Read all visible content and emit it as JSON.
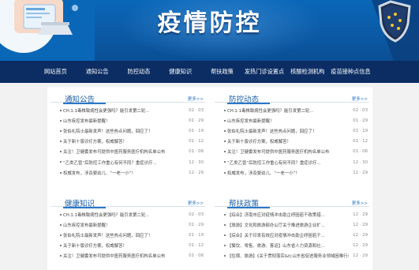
{
  "banner": {
    "title": "疫情防控"
  },
  "nav": {
    "items": [
      {
        "label": "网站首页"
      },
      {
        "label": "通知公告"
      },
      {
        "label": "防控动态"
      },
      {
        "label": "健康知识"
      },
      {
        "label": "帮扶政策"
      },
      {
        "label": "发热门诊设置点"
      },
      {
        "label": "核酸检测机构"
      },
      {
        "label": "疫苗接种点信息"
      }
    ]
  },
  "panels": {
    "notices": {
      "title": "通知公告",
      "more": "更多>>",
      "items": [
        {
          "text": "CH.1.1毒株致病性会更强吗？能引发第二轮...",
          "date": "02 · 03"
        },
        {
          "text": "山东疾控发布最新提醒！",
          "date": "01 · 29"
        },
        {
          "text": "张伯礼院士最新发声！这些热点问题，回应了！",
          "date": "01 · 19"
        },
        {
          "text": "关于新十版诊疗方案，权威解答！",
          "date": "01 · 12"
        },
        {
          "text": "关注！卫健委发布可提供中医药服务医疗机构名单公布",
          "date": "01 · 06"
        },
        {
          "text": "“乙类乙管”后防控工作重心有何不同？重症诊疗...",
          "date": "12 · 30"
        },
        {
          "text": "权威发布，涉及婴幼儿、“一老一小”！",
          "date": "12 · 29"
        }
      ]
    },
    "dynamics": {
      "title": "防控动态",
      "more": "更多>>",
      "items": [
        {
          "text": "CH.1.1毒株致病性会更强吗？能引发第二轮...",
          "date": "02 · 03"
        },
        {
          "text": "山东疾控发布最新提醒！",
          "date": "01 · 29"
        },
        {
          "text": "张伯礼院士最新发声！这些热点问题，回应了！",
          "date": "01 · 19"
        },
        {
          "text": "关于新十版诊疗方案，权威解答！",
          "date": "01 · 12"
        },
        {
          "text": "关注！卫健委发布可提供中医药服务医疗机构名单公布",
          "date": "01 · 06"
        },
        {
          "text": "“乙类乙管”后防控工作重心有何不同？重症诊疗...",
          "date": "12 · 30"
        },
        {
          "text": "权威发布，涉及婴幼儿、“一老一小”！",
          "date": "12 · 29"
        }
      ]
    },
    "health": {
      "title": "健康知识",
      "more": "更多>>",
      "items": [
        {
          "text": "CH.1.1毒株致病性会更强吗？能引发第二轮...",
          "date": "02 · 03"
        },
        {
          "text": "山东疾控发布最新提醒！",
          "date": "01 · 29"
        },
        {
          "text": "张伯礼院士最新发声！这些热点问题，回应了！",
          "date": "01 · 19"
        },
        {
          "text": "关于新十版诊疗方案，权威解答！",
          "date": "01 · 12"
        },
        {
          "text": "关注！卫健委发布可提供中医药服务医疗机构名单公布",
          "date": "01 · 06"
        }
      ]
    },
    "policy": {
      "title": "帮扶政策",
      "more": "更多>>",
      "items": [
        {
          "text": "【综合】济南市应对疫情冲击助企纾困若干政策措...",
          "date": "12 · 29"
        },
        {
          "text": "【旅游】文化和旅游部办公厅关于推进旅游企业扩...",
          "date": "12 · 29"
        },
        {
          "text": "【综合】关于印发有效应对疫情冲击助企纾困若干...",
          "date": "12 · 29"
        },
        {
          "text": "【餐饮、零售、旅游、客运】山东省人力资源和社...",
          "date": "12 · 29"
        },
        {
          "text": "【住宿、旅游】《关于贯彻落实&lt;山东省促进服务业领域困难行业恢...",
          "date": "12 · 29"
        }
      ]
    }
  }
}
